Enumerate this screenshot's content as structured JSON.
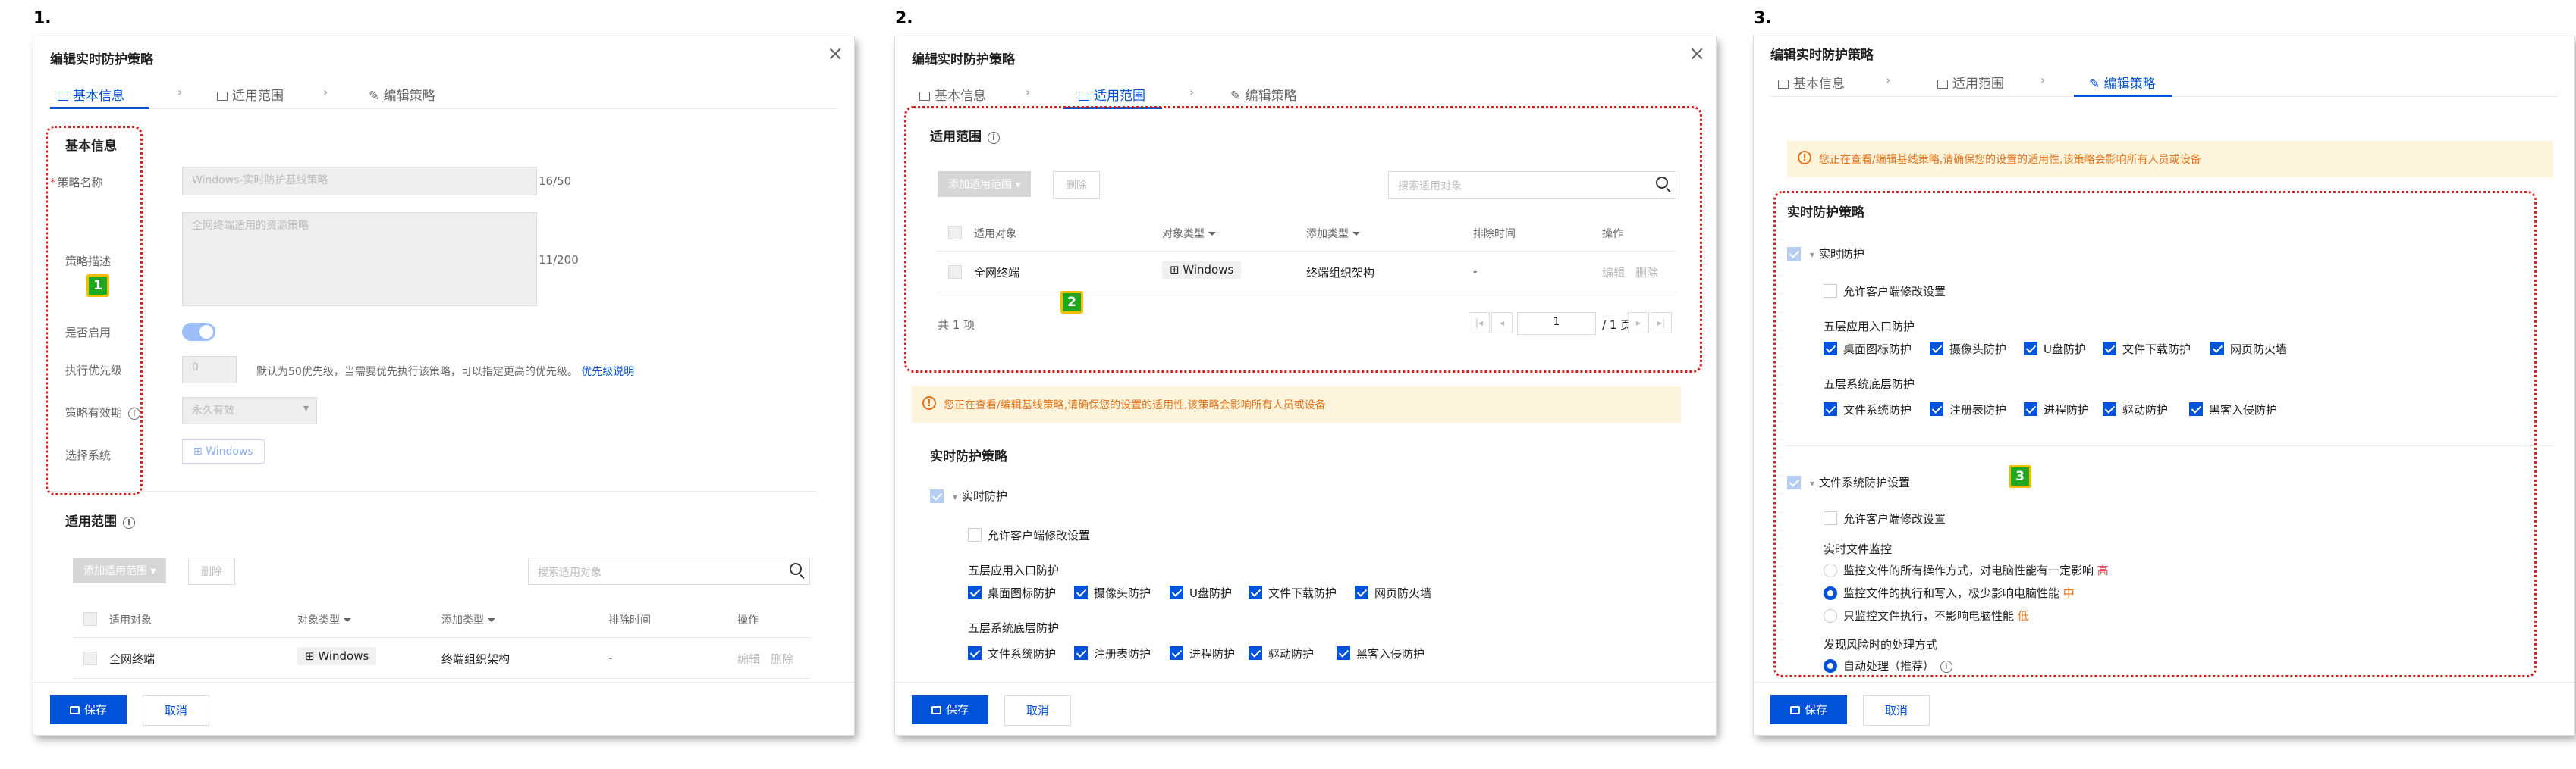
{
  "panel_numbers": [
    "1.",
    "2.",
    "3."
  ],
  "dialog": {
    "title": "编辑实时防护策略",
    "steps": [
      "基本信息",
      "适用范围",
      "编辑策略"
    ],
    "save_label": "保存",
    "cancel_label": "取消"
  },
  "basic": {
    "section_title": "基本信息",
    "name_label": "策略名称",
    "name_value": "Windows-实时防护基线策略",
    "name_count": "16/50",
    "desc_label": "策略描述",
    "desc_value": "全网终端适用的资源策略",
    "desc_count": "11/200",
    "enable_label": "是否启用",
    "priority_label": "执行优先级",
    "priority_value": "0",
    "priority_hint": "默认为50优先级，当需要优先执行该策略，可以指定更高的优先级。",
    "priority_link": "优先级说明",
    "validity_label": "策略有效期",
    "validity_value": "永久有效",
    "system_label": "选择系统",
    "system_value": "Windows"
  },
  "scope": {
    "section_title": "适用范围",
    "add_button": "添加适用范围",
    "delete_button": "删除",
    "search_placeholder": "搜索适用对象",
    "columns": [
      "适用对象",
      "对象类型",
      "添加类型",
      "排除时间",
      "操作"
    ],
    "row": {
      "object": "全网终端",
      "type": "Windows",
      "add_type": "终端组织架构",
      "exclude_time": "-",
      "edit": "编辑",
      "delete": "删除"
    },
    "total": "共 1 项",
    "page": "1",
    "page_total": "/ 1 页"
  },
  "alert_text": "您正在查看/编辑基线策略,请确保您的设置的适用性,该策略会影响所有人员或设备",
  "policy": {
    "section_title": "实时防护策略",
    "realtime_label": "实时防护",
    "allow_client_modify": "允许客户端修改设置",
    "layer5_app_title": "五层应用入口防护",
    "layer5_app_items": [
      "桌面图标防护",
      "摄像头防护",
      "U盘防护",
      "文件下载防护",
      "网页防火墙"
    ],
    "layer5_sys_title": "五层系统底层防护",
    "layer5_sys_items": [
      "文件系统防护",
      "注册表防护",
      "进程防护",
      "驱动防护",
      "黑客入侵防护"
    ],
    "fs_settings_label": "文件系统防护设置",
    "realtime_monitor_title": "实时文件监控",
    "monitor_options": [
      {
        "text": "监控文件的所有操作方式，对电脑性能有一定影响",
        "level": "高"
      },
      {
        "text": "监控文件的执行和写入，极少影响电脑性能",
        "level": "中"
      },
      {
        "text": "只监控文件执行，不影响电脑性能",
        "level": "低"
      }
    ],
    "risk_title": "发现风险时的处理方式",
    "risk_option": "自动处理（推荐）"
  },
  "annotations": [
    "1",
    "2",
    "3"
  ],
  "colors": {
    "primary": "#0052d9",
    "annotation_box": "#d42020",
    "badge": "#1fa81f",
    "warning": "#e37318"
  }
}
